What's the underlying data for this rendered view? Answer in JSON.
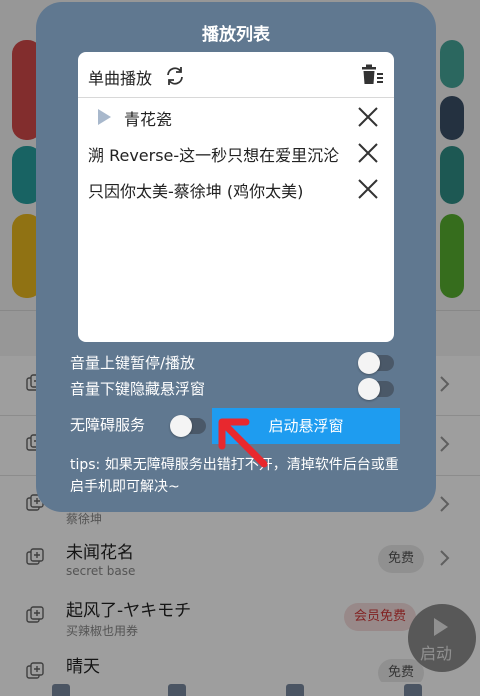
{
  "background": {
    "tile_colors": [
      "#d24a4a",
      "#46a69a",
      "#2f8fd6",
      "#3a5068",
      "#28a0a0",
      "#2f8f86",
      "#e8b820",
      "#58b030",
      "#7e9ab0",
      "#5a8a3a"
    ],
    "rows": [
      {
        "title": "",
        "subtitle": "",
        "badge": ""
      },
      {
        "title": "",
        "subtitle": "",
        "badge": ""
      },
      {
        "title": "",
        "subtitle": "蔡徐坤",
        "badge": ""
      },
      {
        "title": "未闻花名",
        "subtitle": "secret base",
        "badge": "免费",
        "badge_type": "free"
      },
      {
        "title": "起风了-ヤキモチ",
        "subtitle": "买辣椒也用券",
        "badge": "会员免费",
        "badge_type": "vip"
      },
      {
        "title": "晴天",
        "subtitle": "",
        "badge": "免费",
        "badge_type": "free"
      }
    ],
    "float_button_label": "启动",
    "nav_icons": [
      "home-icon",
      "grid-icon",
      "chat-icon",
      "profile-icon"
    ]
  },
  "modal": {
    "title": "播放列表",
    "playlist": {
      "mode_label": "单曲播放",
      "mode_icon": "refresh-icon",
      "clear_icon": "trash-icon",
      "items": [
        {
          "title": "青花瓷",
          "playing": true
        },
        {
          "title": "溯 Reverse-这一秒只想在爱里沉沦"
        },
        {
          "title": "只因你太美-蔡徐坤 (鸡你太美)"
        }
      ]
    },
    "settings": {
      "volume_up_label": "音量上键暂停/播放",
      "volume_down_label": "音量下键隐藏悬浮窗",
      "accessibility_label": "无障碍服务"
    },
    "start_button_label": "启动悬浮窗",
    "tips": "tips: 如果无障碍服务出错打不开，清掉软件后台或重启手机即可解决~"
  },
  "colors": {
    "modal_bg": "#607890",
    "accent": "#1e9cf0",
    "arrow": "#e8282e"
  }
}
